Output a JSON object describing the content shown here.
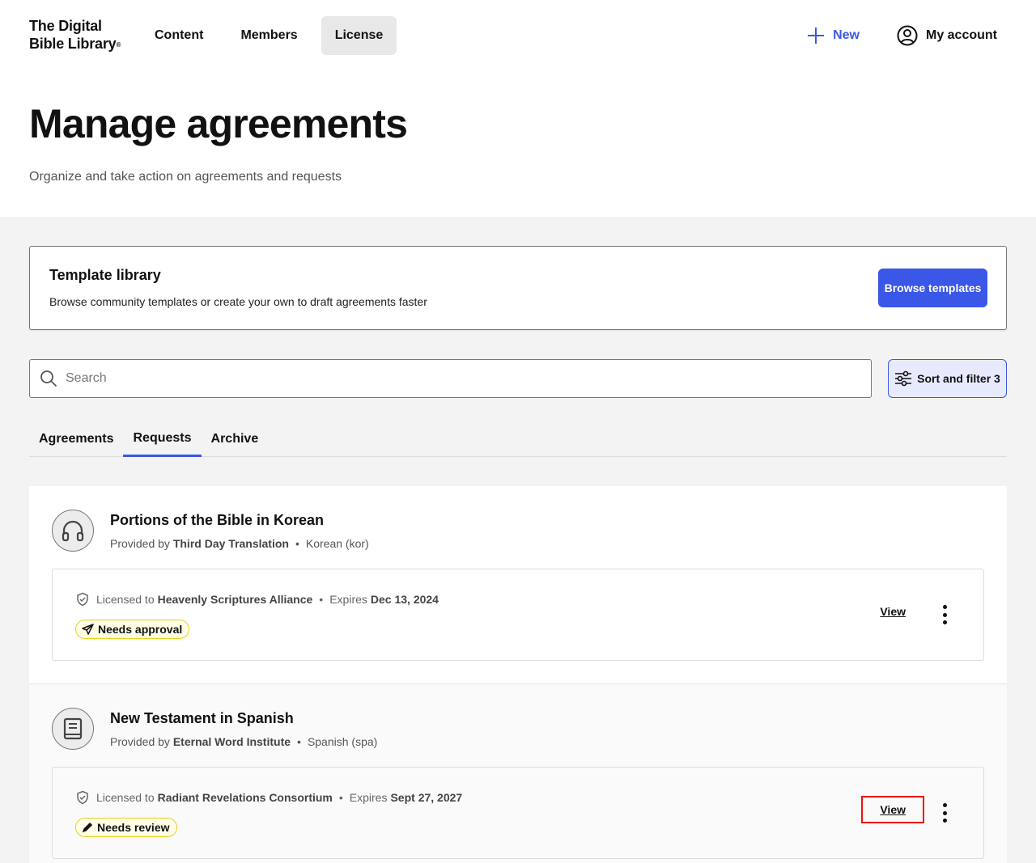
{
  "header": {
    "logo_line1": "The Digital",
    "logo_line2": "Bible Library",
    "logo_mark": "®",
    "nav": [
      {
        "label": "Content",
        "active": false
      },
      {
        "label": "Members",
        "active": false
      },
      {
        "label": "License",
        "active": true
      }
    ],
    "new_label": "New",
    "account_label": "My account"
  },
  "hero": {
    "title": "Manage agreements",
    "subtitle": "Organize and take action on agreements and requests"
  },
  "template_library": {
    "title": "Template library",
    "description": "Browse community templates or create your own to draft agreements faster",
    "button_label": "Browse templates"
  },
  "search": {
    "placeholder": "Search",
    "value": ""
  },
  "sort_filter": {
    "label": "Sort and filter",
    "count": "3"
  },
  "tabs": [
    {
      "label": "Agreements",
      "active": false
    },
    {
      "label": "Requests",
      "active": true
    },
    {
      "label": "Archive",
      "active": false
    }
  ],
  "items": [
    {
      "title": "Portions of the Bible in Korean",
      "provided_by_label": "Provided by",
      "provider": "Third Day Translation",
      "language": "Korean (kor)",
      "icon": "headphones-icon",
      "licensed_to_label": "Licensed to",
      "licensee": "Heavenly Scriptures Alliance",
      "expires_label": "Expires",
      "expires": "Dec 13, 2024",
      "status": "Needs approval",
      "status_icon": "send-icon",
      "view_label": "View"
    },
    {
      "title": "New Testament in Spanish",
      "provided_by_label": "Provided by",
      "provider": "Eternal Word Institute",
      "language": "Spanish (spa)",
      "icon": "book-icon",
      "licensed_to_label": "Licensed to",
      "licensee": "Radiant Revelations Consortium",
      "expires_label": "Expires",
      "expires": "Sept 27, 2027",
      "status": "Needs review",
      "status_icon": "pencil-icon",
      "view_label": "View"
    }
  ],
  "colors": {
    "accent": "#3a57e8",
    "badge_border": "#e8d21a",
    "highlight": "#e11111"
  }
}
